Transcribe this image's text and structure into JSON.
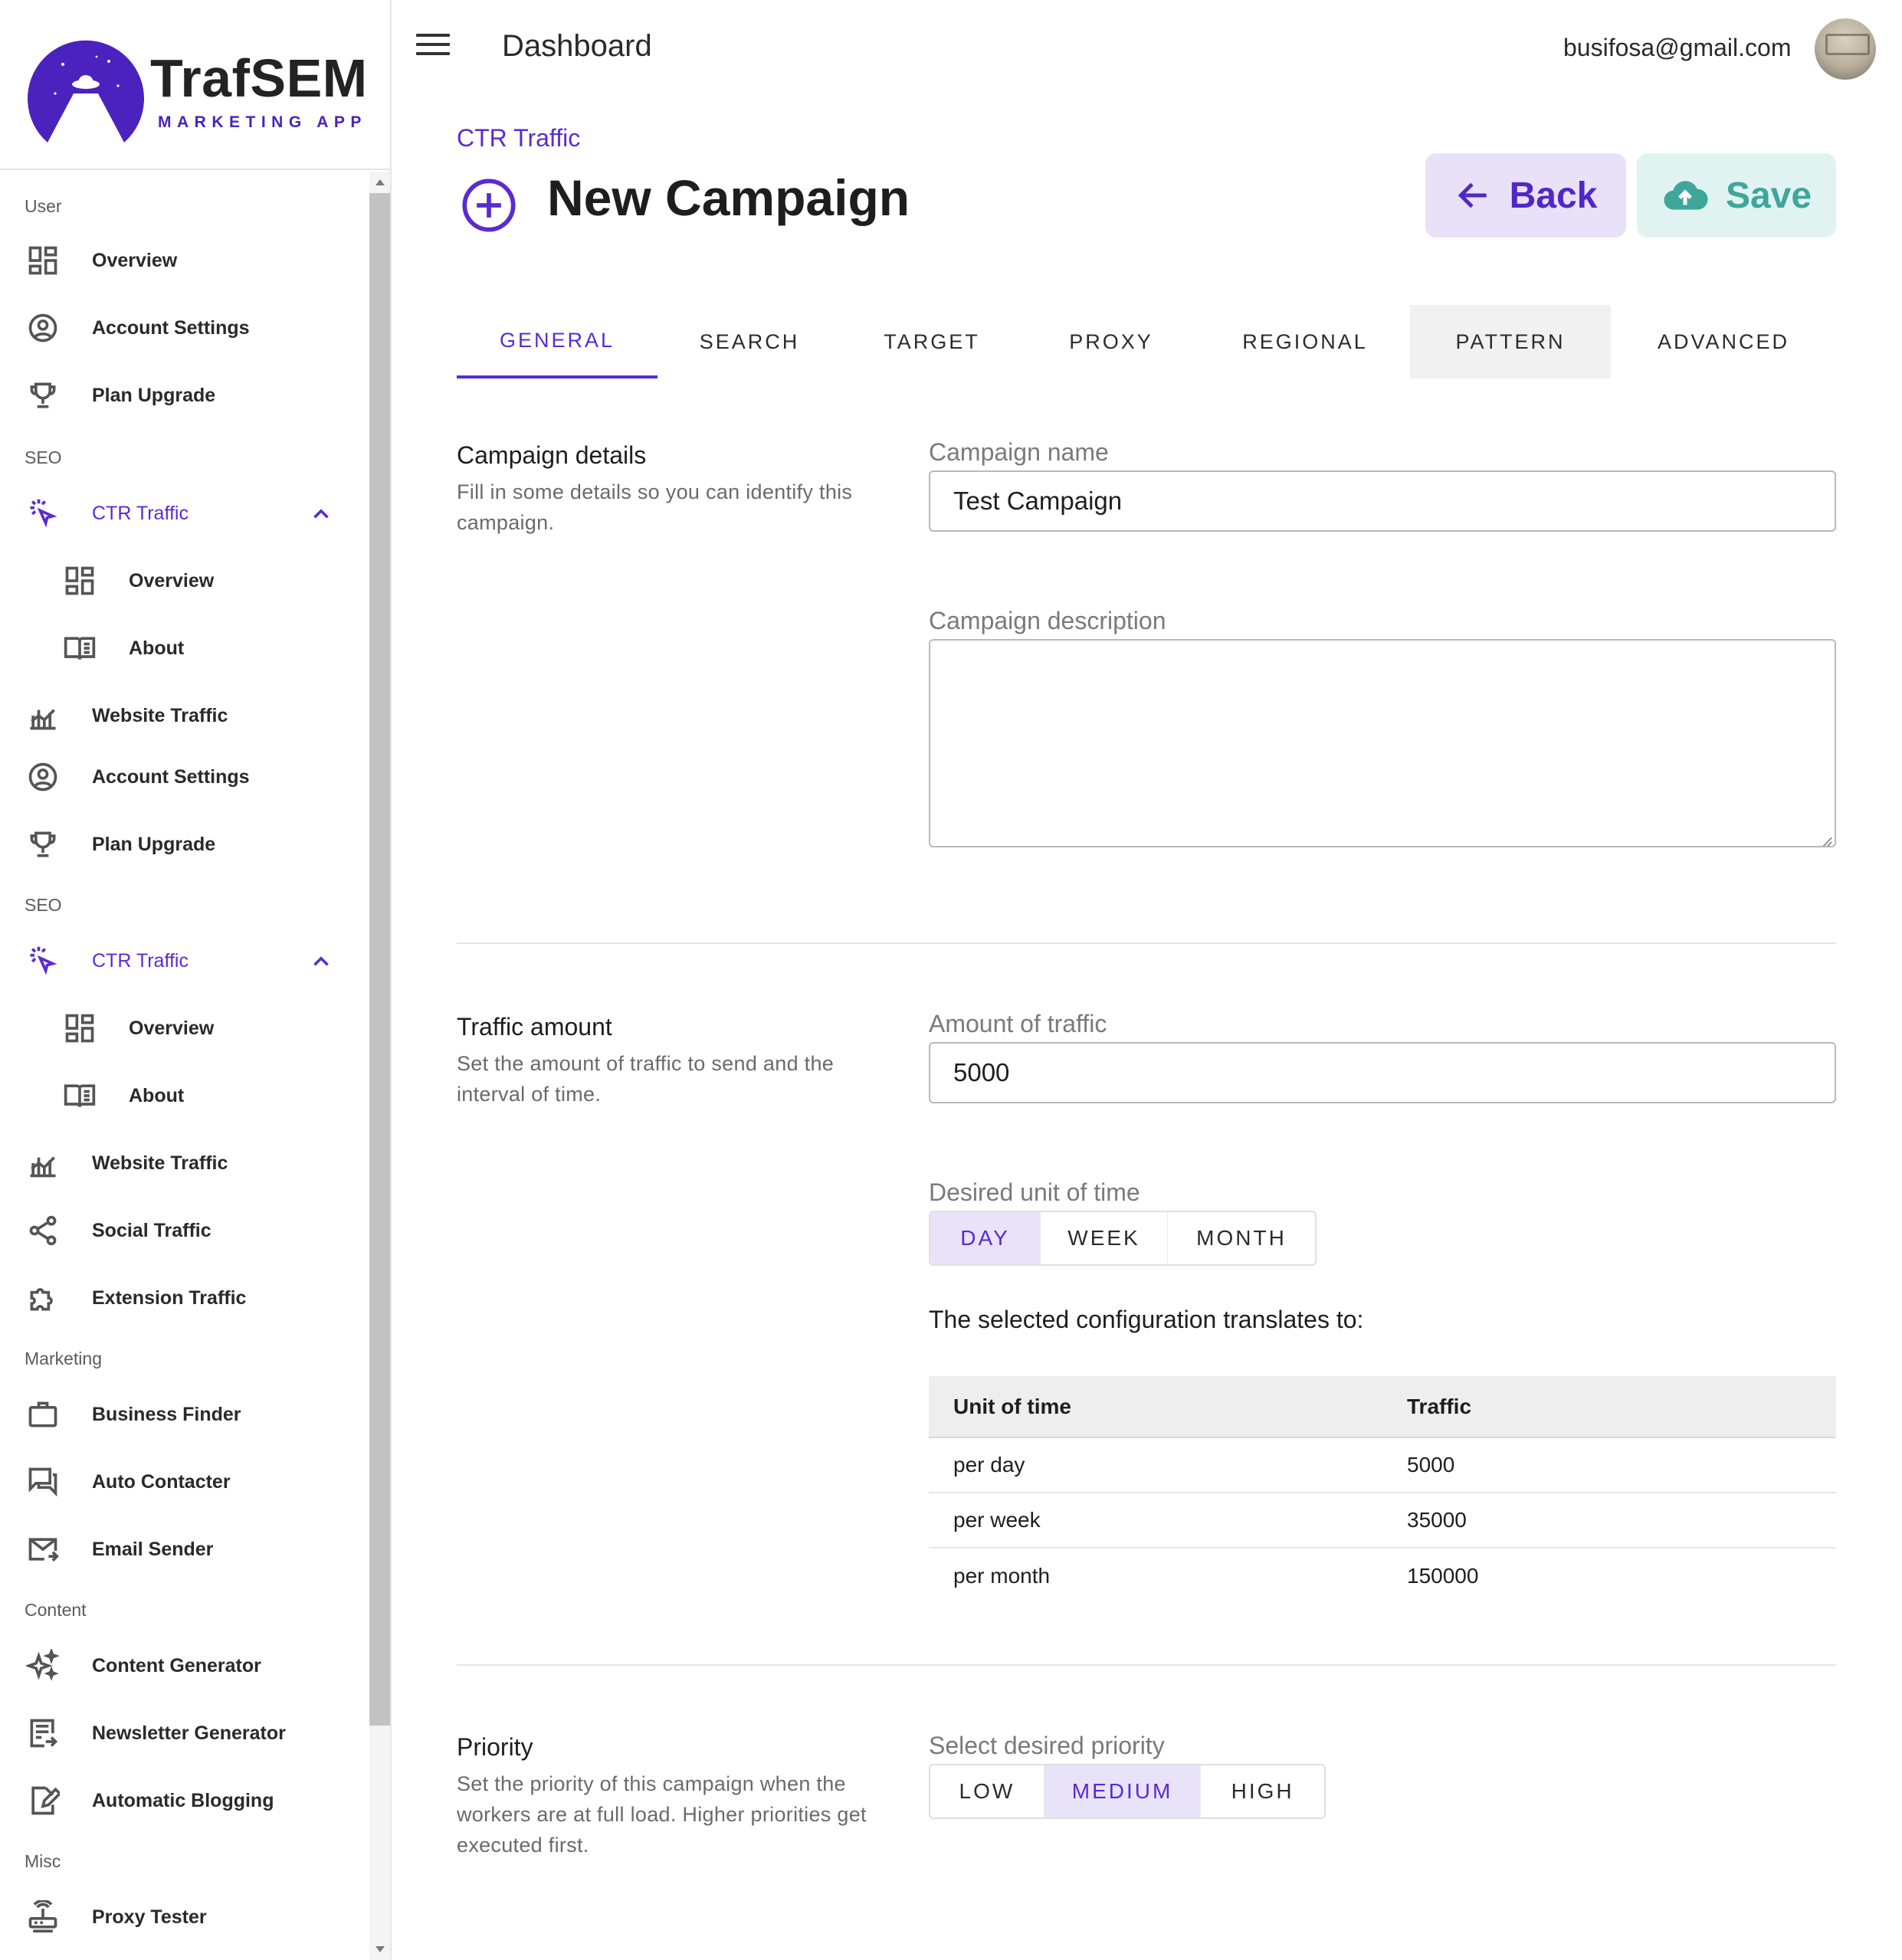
{
  "brand": {
    "title": "TrafSEM",
    "subtitle": "MARKETING APP",
    "accent": "#5a2bd1",
    "logo_bg": "#4b22bd"
  },
  "sidebar": {
    "sections": {
      "user": "User",
      "seo1": "SEO",
      "seo2": "SEO",
      "marketing": "Marketing",
      "content": "Content",
      "misc": "Misc"
    },
    "items": [
      {
        "label": "Overview",
        "icon": "dashboard-icon"
      },
      {
        "label": "Account Settings",
        "icon": "account-circle-icon"
      },
      {
        "label": "Plan Upgrade",
        "icon": "trophy-icon"
      },
      {
        "label": "CTR Traffic",
        "icon": "cursor-click-icon",
        "expanded": true
      },
      {
        "label": "Overview",
        "icon": "dashboard-icon"
      },
      {
        "label": "About",
        "icon": "book-icon"
      },
      {
        "label": "Website Traffic",
        "icon": "chart-bar-icon"
      },
      {
        "label": "Account Settings",
        "icon": "account-circle-icon"
      },
      {
        "label": "Plan Upgrade",
        "icon": "trophy-icon"
      },
      {
        "label": "CTR Traffic",
        "icon": "cursor-click-icon",
        "expanded": true
      },
      {
        "label": "Overview",
        "icon": "dashboard-icon"
      },
      {
        "label": "About",
        "icon": "book-icon"
      },
      {
        "label": "Website Traffic",
        "icon": "chart-bar-icon"
      },
      {
        "label": "Social Traffic",
        "icon": "share-icon"
      },
      {
        "label": "Extension Traffic",
        "icon": "puzzle-icon"
      },
      {
        "label": "Business Finder",
        "icon": "briefcase-icon"
      },
      {
        "label": "Auto Contacter",
        "icon": "chat-icon"
      },
      {
        "label": "Email Sender",
        "icon": "email-icon"
      },
      {
        "label": "Content Generator",
        "icon": "sparkles-icon"
      },
      {
        "label": "Newsletter Generator",
        "icon": "newsletter-icon"
      },
      {
        "label": "Automatic Blogging",
        "icon": "edit-document-icon"
      },
      {
        "label": "Proxy Tester",
        "icon": "router-icon"
      }
    ]
  },
  "header": {
    "title": "Dashboard",
    "user_email": "busifosa@gmail.com"
  },
  "page": {
    "breadcrumb": "CTR Traffic",
    "title": "New Campaign",
    "back_label": "Back",
    "save_label": "Save"
  },
  "tabs": [
    {
      "label": "GENERAL",
      "active": true
    },
    {
      "label": "SEARCH"
    },
    {
      "label": "TARGET"
    },
    {
      "label": "PROXY"
    },
    {
      "label": "REGIONAL"
    },
    {
      "label": "PATTERN",
      "hover": true
    },
    {
      "label": "ADVANCED"
    }
  ],
  "details": {
    "title": "Campaign details",
    "description": "Fill in some details so you can identify this campaign.",
    "name_label": "Campaign name",
    "name_value": "Test Campaign",
    "desc_label": "Campaign description",
    "desc_value": ""
  },
  "traffic": {
    "title": "Traffic amount",
    "description": "Set the amount of traffic to send and the interval of time.",
    "amount_label": "Amount of traffic",
    "amount_value": "5000",
    "unit_label": "Desired unit of time",
    "units": [
      "DAY",
      "WEEK",
      "MONTH"
    ],
    "selected_unit": "DAY",
    "config_text": "The selected configuration translates to:",
    "table": {
      "headers": [
        "Unit of time",
        "Traffic"
      ],
      "rows": [
        [
          "per day",
          "5000"
        ],
        [
          "per week",
          "35000"
        ],
        [
          "per month",
          "150000"
        ]
      ]
    }
  },
  "priority": {
    "title": "Priority",
    "description": "Set the priority of this campaign when the workers are at full load. Higher priorities get executed first.",
    "label": "Select desired priority",
    "options": [
      "LOW",
      "MEDIUM",
      "HIGH"
    ],
    "selected": "MEDIUM"
  }
}
